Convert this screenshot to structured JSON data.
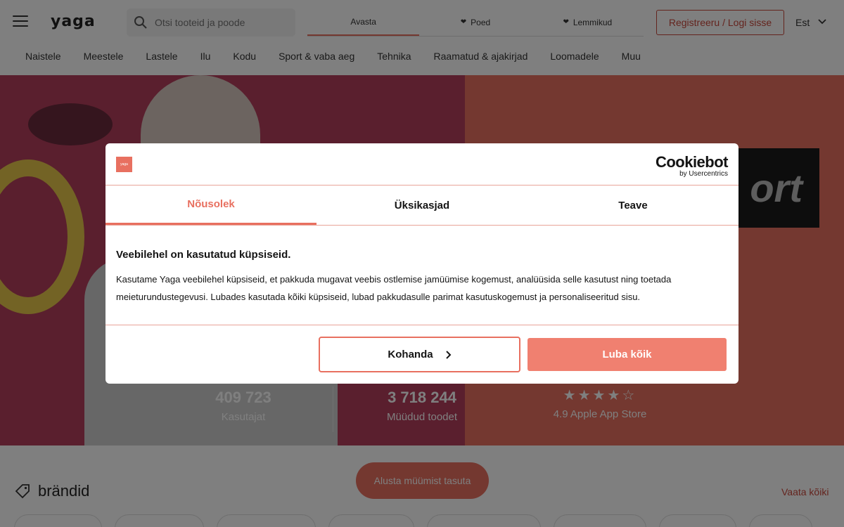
{
  "header": {
    "logo": "yaga",
    "search_placeholder": "Otsi tooteid ja poode",
    "tabs": [
      {
        "label": "Avasta"
      },
      {
        "label": "Poed"
      },
      {
        "label": "Lemmikud"
      }
    ],
    "register_label": "Registreeru / Logi sisse",
    "language": "Est"
  },
  "categories": [
    "Naistele",
    "Meestele",
    "Lastele",
    "Ilu",
    "Kodu",
    "Sport & vaba aeg",
    "Tehnika",
    "Raamatud & ajakirjad",
    "Loomadele",
    "Muu"
  ],
  "hero": {
    "sport_text": "ort",
    "stats": [
      {
        "value": "409 723",
        "label": "Kasutajat"
      },
      {
        "value": "3 718 244",
        "label": "Müüdud toodet"
      }
    ],
    "rating_label": "4.9 Apple App Store",
    "stars": "★★★★☆",
    "start_button": "Alusta müümist tasuta"
  },
  "brands": {
    "title": "brändid",
    "see_all": "Vaata kõiki"
  },
  "cookie_dialog": {
    "logo_text": "yaga",
    "provider_name": "Cookiebot",
    "provider_by": "by Usercentrics",
    "tabs": [
      {
        "label": "Nõusolek"
      },
      {
        "label": "Üksikasjad"
      },
      {
        "label": "Teave"
      }
    ],
    "title": "Veebilehel on kasutatud küpsiseid.",
    "body": "Kasutame Yaga veebilehel küpsiseid, et pakkuda mugavat veebis ostlemise jamüümise kogemust, analüüsida selle kasutust ning toetada meieturundustegevusi. Lubades kasutada kõiki küpsiseid, lubad pakkudasulle parimat kasutuskogemust ja personaliseeritud sisu.",
    "customize_label": "Kohanda",
    "allow_all_label": "Luba kõik"
  },
  "colors": {
    "accent": "#e87060",
    "accent_dark": "#c9483c"
  }
}
